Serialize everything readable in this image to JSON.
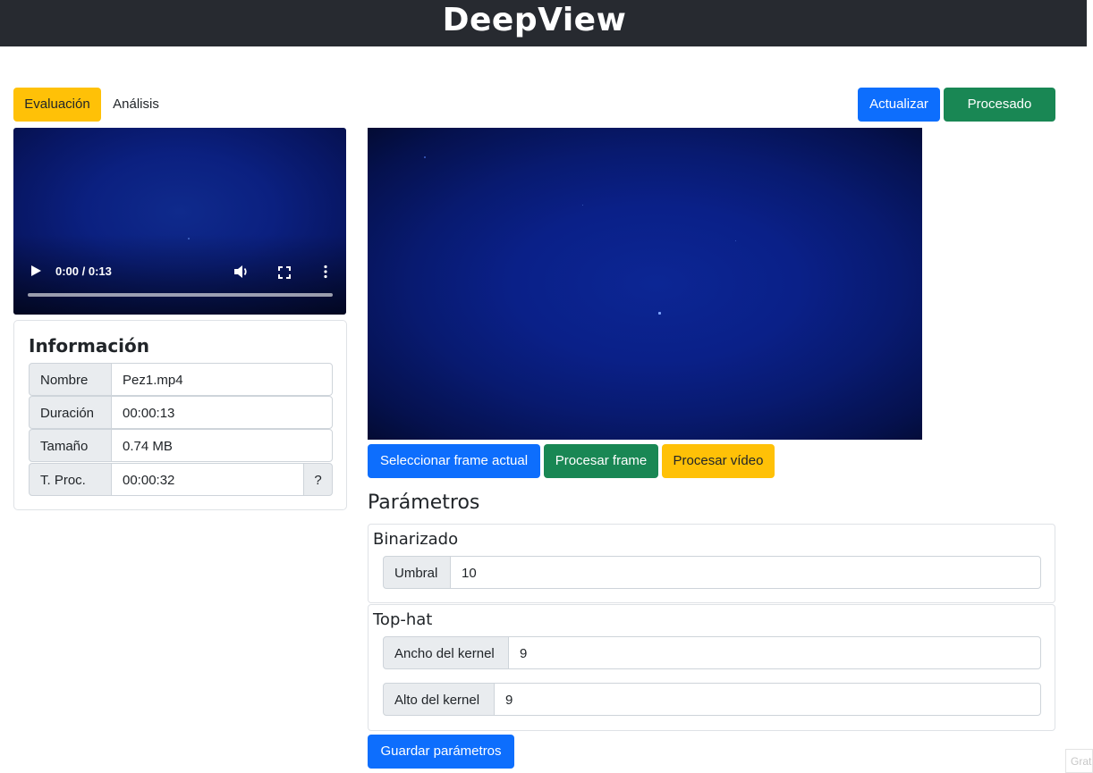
{
  "app": {
    "title": "DeepView"
  },
  "tabs": [
    {
      "label": "Evaluación",
      "active": true
    },
    {
      "label": "Análisis",
      "active": false
    }
  ],
  "toolbar": {
    "refresh_label": "Actualizar",
    "processed_label": "Procesado"
  },
  "video_player": {
    "time": "0:00 / 0:13",
    "progress": 0
  },
  "info": {
    "title": "Información",
    "rows": [
      {
        "label": "Nombre",
        "value": "Pez1.mp4"
      },
      {
        "label": "Duración",
        "value": "00:00:13"
      },
      {
        "label": "Tamaño",
        "value": "0.74 MB"
      },
      {
        "label": "T. Proc.",
        "value": "00:00:32",
        "help": "?"
      }
    ]
  },
  "actions": {
    "select_frame": "Seleccionar frame actual",
    "process_frame": "Procesar frame",
    "process_video": "Procesar vídeo"
  },
  "params": {
    "title": "Parámetros",
    "binarizado": {
      "title": "Binarizado",
      "umbral_label": "Umbral",
      "umbral_value": "10"
    },
    "tophat": {
      "title": "Top-hat",
      "ancho_label": "Ancho del kernel",
      "ancho_value": "9",
      "alto_label": "Alto del kernel",
      "alto_value": "9"
    },
    "save_label": "Guardar parámetros"
  },
  "corner_tag": "Grat",
  "colors": {
    "primary": "#0d6efd",
    "success": "#198754",
    "warning": "#ffc107",
    "topbar": "#272a30"
  }
}
